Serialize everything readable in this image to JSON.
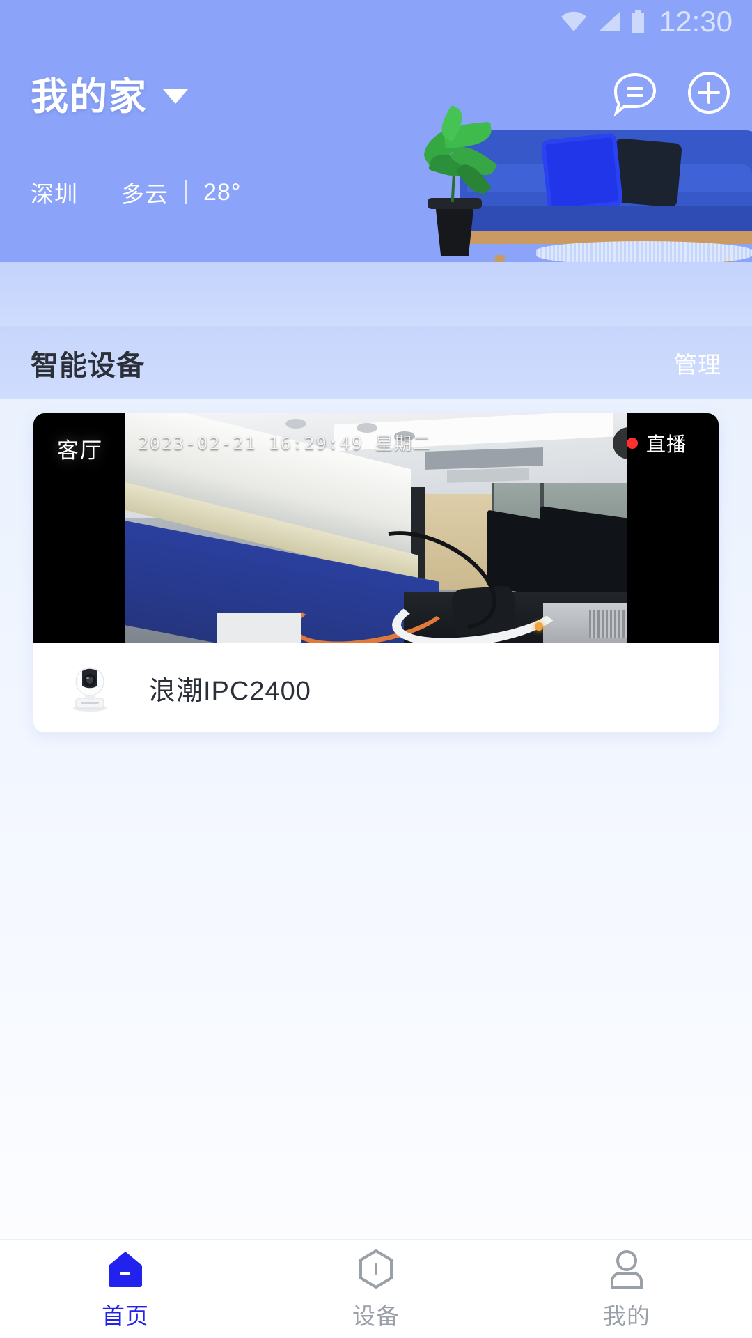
{
  "statusbar": {
    "wifi_icon": "wifi-icon",
    "signal_icon": "signal-icon",
    "battery_icon": "battery-icon",
    "clock": "12:30"
  },
  "header": {
    "home_name": "我的家",
    "dropdown_icon": "chevron-down-icon",
    "message_icon": "message-bubble-icon",
    "add_icon": "plus-circle-icon",
    "bg_color": "#8ba4f9"
  },
  "weather": {
    "city": "深圳",
    "condition": "多云",
    "divider": "|",
    "temperature": "28°"
  },
  "section": {
    "title": "智能设备",
    "action_label": "管理"
  },
  "device_card": {
    "room_tag": "客厅",
    "timestamp": "2023-02-21  16:29:49  星期二",
    "live_badge": "直播",
    "live_dot_color": "#ff2f2f",
    "device_icon": "ip-camera-icon",
    "device_name": "浪潮IPC2400"
  },
  "tabbar": {
    "items": [
      {
        "label": "首页",
        "icon": "home-icon",
        "active": true
      },
      {
        "label": "设备",
        "icon": "device-hex-icon",
        "active": false
      },
      {
        "label": "我的",
        "icon": "person-icon",
        "active": false
      }
    ],
    "active_color": "#2222ee",
    "inactive_color": "#9aa0a8"
  }
}
